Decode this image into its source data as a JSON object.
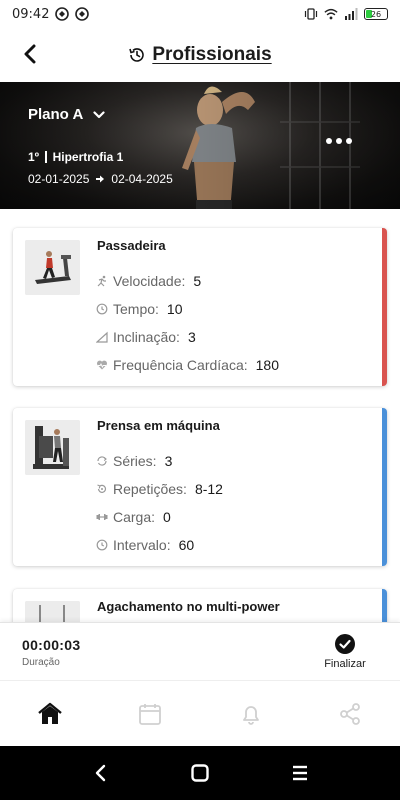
{
  "status_bar": {
    "time": "09:42",
    "battery": "26"
  },
  "header": {
    "title": "Profissionais",
    "back_icon": "chevron-left-icon",
    "title_icon": "history-icon"
  },
  "plan": {
    "name": "Plano A",
    "order": "1º",
    "workout": "Hipertrofia 1",
    "start_date": "02-01-2025",
    "end_date": "02-04-2025"
  },
  "exercises": [
    {
      "title": "Passadeira",
      "accent": "#d9534f",
      "metrics": [
        {
          "icon": "runner-icon",
          "label": "Velocidade:",
          "value": "5"
        },
        {
          "icon": "clock-icon",
          "label": "Tempo:",
          "value": "10"
        },
        {
          "icon": "slope-icon",
          "label": "Inclinação:",
          "value": "3"
        },
        {
          "icon": "heartbeat-icon",
          "label": "Frequência Cardíaca:",
          "value": "180"
        }
      ]
    },
    {
      "title": "Prensa em máquina",
      "accent": "#4a90d9",
      "metrics": [
        {
          "icon": "repeat-icon",
          "label": "Séries:",
          "value": "3"
        },
        {
          "icon": "rotate-icon",
          "label": "Repetições:",
          "value": "8-12"
        },
        {
          "icon": "dumbbell-icon",
          "label": "Carga:",
          "value": "0"
        },
        {
          "icon": "clock-icon",
          "label": "Intervalo:",
          "value": "60"
        }
      ]
    },
    {
      "title": "Agachamento no multi-power",
      "accent": "#4a90d9",
      "metrics": []
    }
  ],
  "timer": {
    "value": "00:00:03",
    "label": "Duração",
    "finish_label": "Finalizar"
  },
  "bottom_nav": [
    {
      "icon": "home-icon",
      "active": true
    },
    {
      "icon": "calendar-icon",
      "active": false
    },
    {
      "icon": "bell-icon",
      "active": false
    },
    {
      "icon": "share-icon",
      "active": false
    }
  ],
  "colors": {
    "accent_red": "#d9534f",
    "accent_blue": "#4a90d9",
    "text_primary": "#1a1a1a",
    "text_secondary": "#666666"
  }
}
